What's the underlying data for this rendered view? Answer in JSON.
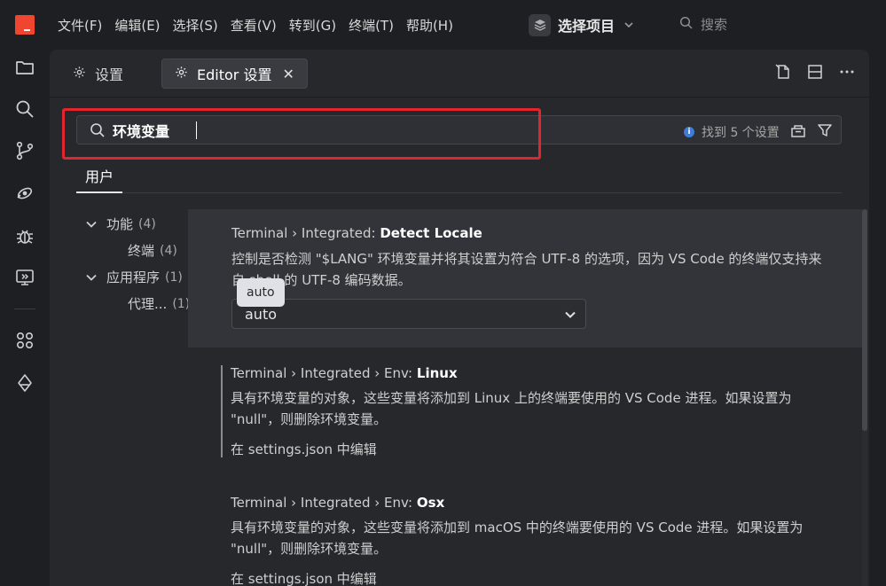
{
  "menu": {
    "items": [
      "文件(F)",
      "编辑(E)",
      "选择(S)",
      "查看(V)",
      "转到(G)",
      "终端(T)",
      "帮助(H)"
    ],
    "project_label": "选择项目",
    "search_placeholder": "搜索"
  },
  "tabs": {
    "settings": "设置",
    "editor_settings": "Editor 设置",
    "close_glyph": "✕"
  },
  "search": {
    "value": "环境变量",
    "results_text": "找到 5 个设置"
  },
  "scope": {
    "user_tab": "用户"
  },
  "toc": [
    {
      "label": "功能",
      "count": "(4)"
    },
    {
      "label": "终端",
      "count": "(4)"
    },
    {
      "label": "应用程序",
      "count": "(1)"
    },
    {
      "label": "代理...",
      "count": "(1)"
    }
  ],
  "settings": [
    {
      "prefix": "Terminal › Integrated: ",
      "name": "Detect Locale",
      "desc": "控制是否检测 \"$LANG\" 环境变量并将其设置为符合 UTF-8 的选项，因为 VS Code 的终端仅支持来自 shell 的 UTF-8 编码数据。",
      "value": "auto",
      "tooltip": "auto"
    },
    {
      "prefix": "Terminal › Integrated › Env: ",
      "name": "Linux",
      "desc": "具有环境变量的对象，这些变量将添加到 Linux 上的终端要使用的 VS Code 进程。如果设置为 \"null\"，则删除环境变量。",
      "edit": "在 settings.json 中编辑"
    },
    {
      "prefix": "Terminal › Integrated › Env: ",
      "name": "Osx",
      "desc": "具有环境变量的对象，这些变量将添加到 macOS 中的终端要使用的 VS Code 进程。如果设置为 \"null\"，则删除环境变量。",
      "edit": "在 settings.json 中编辑"
    }
  ],
  "colors": {
    "accent_red": "#e0262f",
    "logo": "#f0462f",
    "info_blue": "#3d7dd8"
  }
}
